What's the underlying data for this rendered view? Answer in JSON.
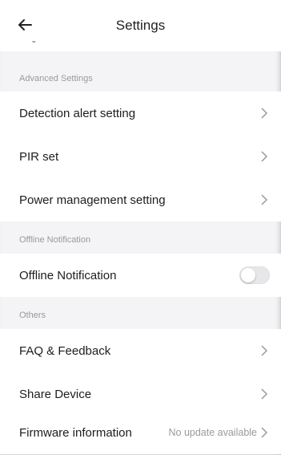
{
  "header": {
    "title": "Settings",
    "partial_text": "ˇ"
  },
  "sections": {
    "advanced": "Advanced Settings",
    "offline": "Offline Notification",
    "others": "Others"
  },
  "items": {
    "detection_alert": "Detection alert setting",
    "pir": "PIR set",
    "power": "Power management setting",
    "offline_notification": "Offline Notification",
    "faq": "FAQ & Feedback",
    "share": "Share Device",
    "firmware": "Firmware information",
    "firmware_status": "No update available"
  },
  "toggles": {
    "offline_notification_on": false
  },
  "colors": {
    "background": "#f4f4f6",
    "row": "#ffffff",
    "muted_text": "#9a9a9a",
    "toggle_off": "#e7e7e9"
  }
}
